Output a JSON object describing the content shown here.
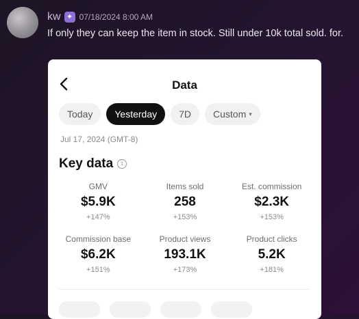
{
  "message": {
    "username": "kw",
    "badge_icon": "verified-badge-icon",
    "timestamp": "07/18/2024 8:00 AM",
    "text": "If only they can keep the item in stock. Still under 10k total sold. for."
  },
  "card": {
    "title": "Data",
    "back_icon": "chevron-left-icon",
    "tabs": [
      {
        "label": "Today",
        "active": false
      },
      {
        "label": "Yesterday",
        "active": true
      },
      {
        "label": "7D",
        "active": false
      },
      {
        "label": "Custom",
        "active": false
      }
    ],
    "date": "Jul 17, 2024 (GMT-8)",
    "section_title": "Key data",
    "metrics": [
      {
        "label": "GMV",
        "value": "$5.9K",
        "change": "+147%"
      },
      {
        "label": "Items sold",
        "value": "258",
        "change": "+153%"
      },
      {
        "label": "Est. commission",
        "value": "$2.3K",
        "change": "+153%"
      },
      {
        "label": "Commission base",
        "value": "$6.2K",
        "change": "+151%"
      },
      {
        "label": "Product views",
        "value": "193.1K",
        "change": "+173%"
      },
      {
        "label": "Product clicks",
        "value": "5.2K",
        "change": "+181%"
      }
    ]
  }
}
